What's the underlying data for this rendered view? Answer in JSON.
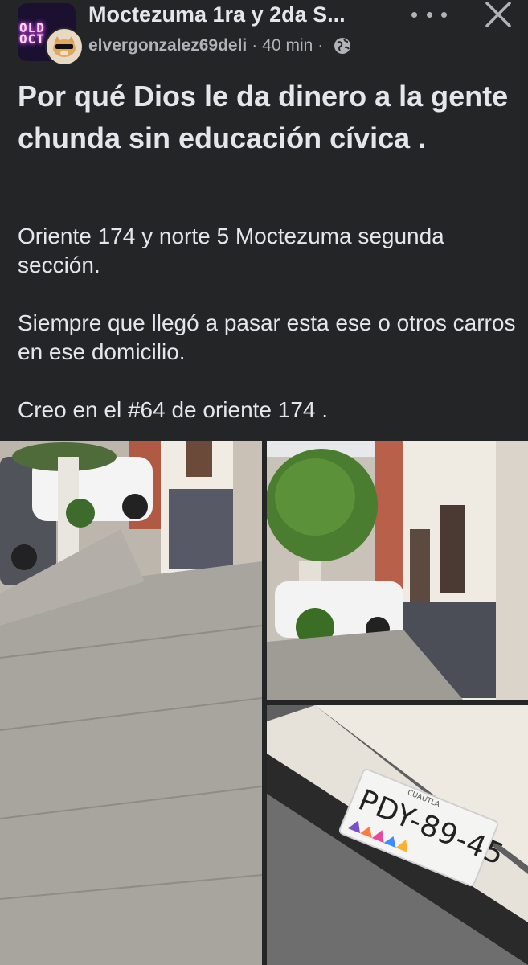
{
  "header": {
    "group_name": "Moctezuma 1ra y 2da S...",
    "group_avatar_text": "OLD\nOCT",
    "author": "elvergonzalez69deli",
    "separator": "·",
    "time": "40 min",
    "separator2": "·",
    "privacy_icon": "globe-icon",
    "more_icon": "more-horizontal-icon",
    "close_icon": "close-icon"
  },
  "post": {
    "title": "Por qué Dios le da dinero a la gente chunda sin educación cívica .",
    "paragraphs": [
      "Oriente 174 y norte 5 Moctezuma segunda sección.",
      "Siempre que llegó a pasar esta ese o otros carros en ese domicilio.",
      "Creo en el #64 de oriente 174 ."
    ]
  },
  "photos": {
    "plate_text": "PDY-89-45",
    "plate_state": "CUAUTLA"
  },
  "colors": {
    "background": "#242526",
    "text_primary": "#e4e6eb",
    "text_secondary": "#b0b3b8"
  }
}
